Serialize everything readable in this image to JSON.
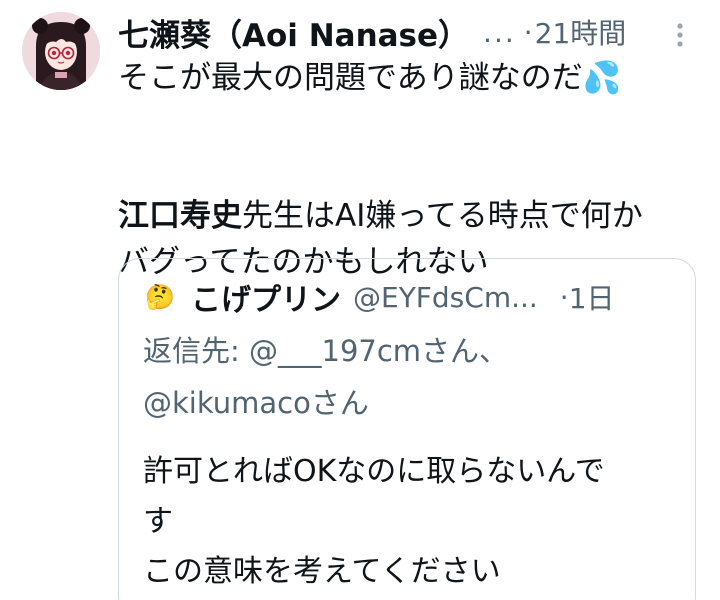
{
  "tweet": {
    "author": {
      "display_name": "七瀬葵（Aoi Nanase）",
      "handle_truncated": "...",
      "avatar_icon": "anime-girl-avatar"
    },
    "separator": "·",
    "time": "21時間",
    "more_icon": "more-vertical-icon",
    "body": {
      "line1": "そこが最大の問題であり謎なのだ",
      "line1_emoji": "💦",
      "mention_name": "江口寿史",
      "line3_rest": "先生はAI嫌ってる時点で何か",
      "line4": "バグってたのかもしれない"
    }
  },
  "quoted_tweet": {
    "author": {
      "emoji": "🤔",
      "display_name": "こげプリン",
      "handle": "@EYFdsCm...",
      "avatar_icon": "thinking-face-icon"
    },
    "separator": "·",
    "time": "1日",
    "reply_prefix": "返信先: @___197cmさん、",
    "reply_line2": "@kikumacoさん",
    "text_line1": "許可とればOKなのに取らないんで",
    "text_line2": "す",
    "text_line3": "この意味を考えてください"
  },
  "colors": {
    "primary_text": "#0f1419",
    "secondary_text": "#536471",
    "border": "#cfd9de",
    "background": "#ffffff"
  }
}
